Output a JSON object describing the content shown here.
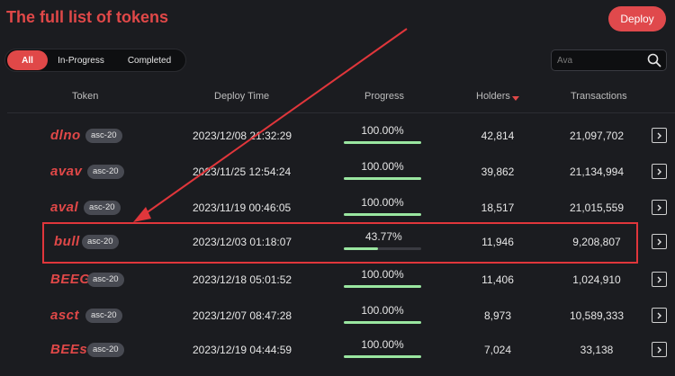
{
  "header": {
    "title": "The full list of tokens",
    "deploy_label": "Deploy"
  },
  "tabs": [
    {
      "label": "All",
      "active": true
    },
    {
      "label": "In-Progress",
      "active": false
    },
    {
      "label": "Completed",
      "active": false
    }
  ],
  "search": {
    "value": "",
    "placeholder": "Ava"
  },
  "columns": {
    "token": "Token",
    "deploy_time": "Deploy Time",
    "progress": "Progress",
    "holders": "Holders",
    "transactions": "Transactions"
  },
  "rows": [
    {
      "name": "dlno",
      "badge": "asc-20",
      "deploy_time": "2023/12/08 21:32:29",
      "progress": "100.00%",
      "progress_value": 100.0,
      "holders": "42,814",
      "transactions": "21,097,702"
    },
    {
      "name": "avav",
      "badge": "asc-20",
      "deploy_time": "2023/11/25 12:54:24",
      "progress": "100.00%",
      "progress_value": 100.0,
      "holders": "39,862",
      "transactions": "21,134,994"
    },
    {
      "name": "aval",
      "badge": "asc-20",
      "deploy_time": "2023/11/19 00:46:05",
      "progress": "100.00%",
      "progress_value": 100.0,
      "holders": "18,517",
      "transactions": "21,015,559"
    },
    {
      "name": "bull",
      "badge": "asc-20",
      "deploy_time": "2023/12/03 01:18:07",
      "progress": "43.77%",
      "progress_value": 43.77,
      "holders": "11,946",
      "transactions": "9,208,807"
    },
    {
      "name": "BEEG",
      "badge": "asc-20",
      "deploy_time": "2023/12/18 05:01:52",
      "progress": "100.00%",
      "progress_value": 100.0,
      "holders": "11,406",
      "transactions": "1,024,910"
    },
    {
      "name": "asct",
      "badge": "asc-20",
      "deploy_time": "2023/12/07 08:47:28",
      "progress": "100.00%",
      "progress_value": 100.0,
      "holders": "8,973",
      "transactions": "10,589,333"
    },
    {
      "name": "BEEs",
      "badge": "asc-20",
      "deploy_time": "2023/12/19 04:44:59",
      "progress": "100.00%",
      "progress_value": 100.0,
      "holders": "7,024",
      "transactions": "33,138"
    }
  ],
  "colors": {
    "accent": "#e04848",
    "progress_fill": "#9ae6a0",
    "annotation": "#e0363b"
  },
  "icons": {
    "search": "search-icon",
    "sort": "sort-desc-icon",
    "row_action": "chevron-right-icon"
  }
}
